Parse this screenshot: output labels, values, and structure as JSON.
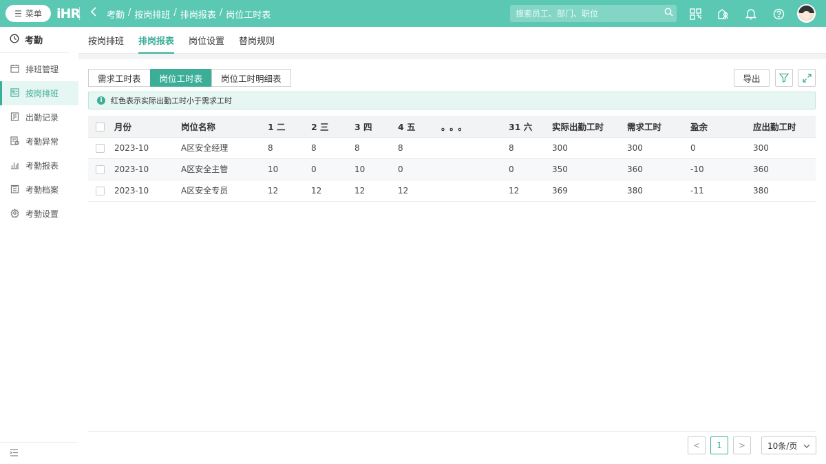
{
  "topbar": {
    "menu_label": "菜单",
    "logo_text": "iHR",
    "breadcrumb": [
      "考勤",
      "按岗排班",
      "排岗报表",
      "岗位工时表"
    ],
    "breadcrumb_sep": "/",
    "search_placeholder": "搜索员工、部门、职位",
    "icons": [
      "qrcode-icon",
      "org-icon",
      "bell-icon",
      "help-icon",
      "avatar"
    ]
  },
  "sidebar": {
    "title": "考勤",
    "items": [
      {
        "label": "排班管理",
        "icon": "calendar-icon"
      },
      {
        "label": "按岗排班",
        "icon": "post-schedule-icon",
        "active": true
      },
      {
        "label": "出勤记录",
        "icon": "record-icon"
      },
      {
        "label": "考勤异常",
        "icon": "exception-icon"
      },
      {
        "label": "考勤报表",
        "icon": "chart-icon"
      },
      {
        "label": "考勤档案",
        "icon": "archive-icon"
      },
      {
        "label": "考勤设置",
        "icon": "gear-icon"
      }
    ]
  },
  "subtabs": [
    "按岗排班",
    "排岗报表",
    "岗位设置",
    "替岗规则"
  ],
  "active_subtab": "排岗报表",
  "segments": [
    "需求工时表",
    "岗位工时表",
    "岗位工时明细表"
  ],
  "active_segment": "岗位工时表",
  "toolbar": {
    "export_label": "导出"
  },
  "notice": "红色表示实际出勤工时小于需求工时",
  "table": {
    "headers": [
      "月份",
      "岗位名称",
      "1 二",
      "2 三",
      "3 四",
      "4 五",
      "。。。",
      "31 六",
      "实际出勤工时",
      "需求工时",
      "盈余",
      "应出勤工时"
    ],
    "rows": [
      [
        "2023-10",
        "A区安全经理",
        "8",
        "8",
        "8",
        "8",
        "",
        "8",
        "300",
        "300",
        "0",
        "300"
      ],
      [
        "2023-10",
        "A区安全主管",
        "10",
        "0",
        "10",
        "0",
        "",
        "0",
        "350",
        "360",
        "-10",
        "360"
      ],
      [
        "2023-10",
        "A区安全专员",
        "12",
        "12",
        "12",
        "12",
        "",
        "12",
        "369",
        "380",
        "-11",
        "380"
      ]
    ]
  },
  "pagination": {
    "prev": "<",
    "current": "1",
    "next": ">",
    "page_size": "10条/页"
  },
  "colors": {
    "primary": "#3cae98",
    "topbar": "#5ac8b2",
    "negative": "#e04545"
  }
}
